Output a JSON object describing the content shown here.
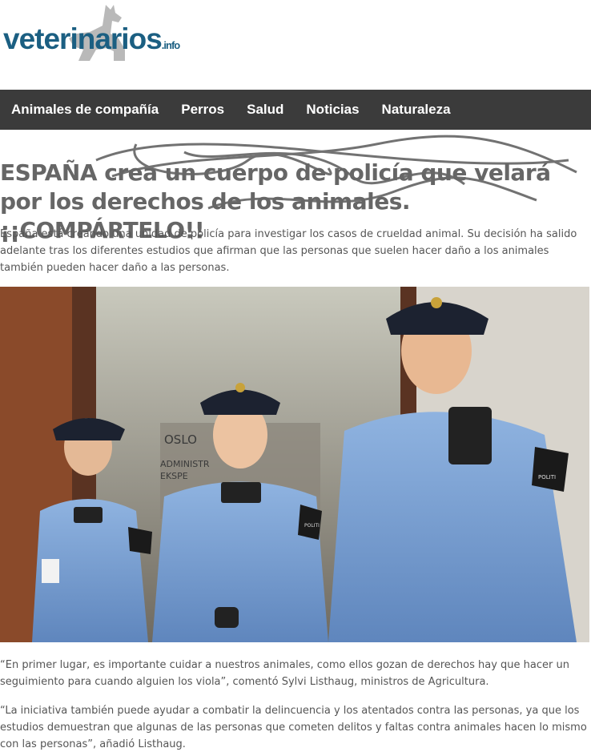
{
  "site": {
    "logo_text": "veterinarios",
    "logo_suffix": ".info"
  },
  "nav": {
    "items": [
      {
        "label": "Animales de compañía"
      },
      {
        "label": "Perros"
      },
      {
        "label": "Salud"
      },
      {
        "label": "Noticias"
      },
      {
        "label": "Naturaleza"
      }
    ]
  },
  "article": {
    "title": "ESPAÑA crea un cuerpo de policía que velará por los derechos de los animales. ¡¡COMPÁRTELO!!",
    "intro": "España está creando una unidad de policía para investigar los casos de crueldad animal. Su decisión ha salido adelante tras los diferentes estudios que afirman que las personas que suelen hacer daño a los animales también pueden hacer daño a las personas.",
    "photo_sign_line1": "OSLO",
    "photo_sign_line2": "ADMINISTR",
    "photo_sign_line3": "EKSPE",
    "patch_label": "POLITI",
    "quote1": "“En primer lugar, es importante cuidar a nuestros animales, como ellos gozan de derechos hay que hacer un seguimiento para cuando alguien los viola”, comentó Sylvi Listhaug, ministros de Agricultura.",
    "quote2": "“La iniciativa también puede ayudar a combatir la delincuencia y los atentados contra las personas, ya que los estudios demuestran que algunas de las personas que cometen delitos y faltas contra animales hacen lo mismo con las personas”, añadió Listhaug."
  },
  "colors": {
    "nav_bg": "#3b3b3b",
    "logo_blue": "#1b5f82",
    "headline": "#666666",
    "uniform": "#7fa6d8"
  }
}
